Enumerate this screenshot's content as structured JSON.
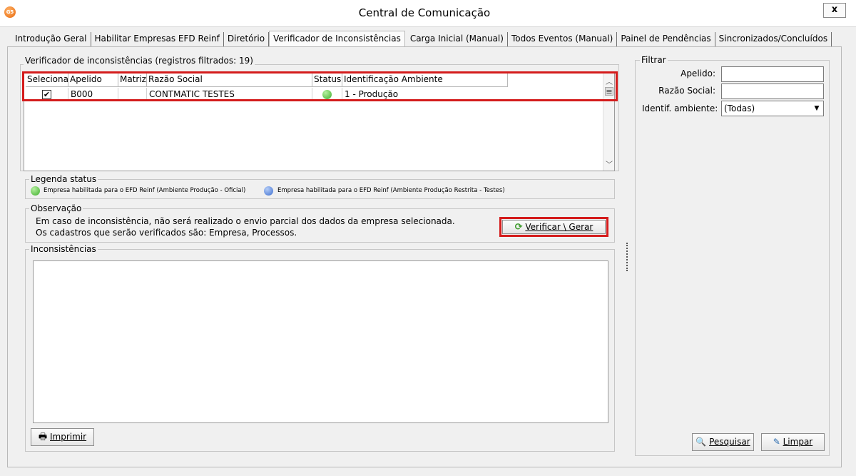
{
  "window": {
    "title": "Central de Comunicação",
    "close": "x",
    "app_icon": "G5"
  },
  "tabs": [
    {
      "label": "Introdução Geral",
      "active": false
    },
    {
      "label": "Habilitar Empresas EFD Reinf",
      "active": false
    },
    {
      "label": "Diretório",
      "active": false
    },
    {
      "label": "Verificador de Inconsistências",
      "active": true
    },
    {
      "label": "Carga Inicial (Manual)",
      "active": false
    },
    {
      "label": "Todos Eventos (Manual)",
      "active": false
    },
    {
      "label": "Painel de Pendências",
      "active": false
    },
    {
      "label": "Sincronizados/Concluídos",
      "active": false
    }
  ],
  "verifier": {
    "group_label": "Verificador de inconsistências (registros filtrados: 19)",
    "columns": [
      "Selecionar",
      "Apelido",
      "Matriz",
      "Razão Social",
      "Status",
      "Identificação Ambiente"
    ],
    "rows": [
      {
        "selected": true,
        "apelido": "B000",
        "matriz": "",
        "razao_social": "CONTMATIC  TESTES",
        "status_color": "#4cbb3a",
        "ambiente": "1 - Produção"
      }
    ]
  },
  "legend": {
    "group_label": "Legenda status",
    "items": [
      {
        "label": "Empresa habilitada para o EFD Reinf (Ambiente Produção - Oficial)",
        "color": "#4cbb3a"
      },
      {
        "label": "Empresa habilitada para o EFD Reinf (Ambiente Produção Restrita - Testes)",
        "color": "#3d6fd1"
      }
    ]
  },
  "observacao": {
    "group_label": "Observação",
    "line1": "Em caso de inconsistência, não será realizado o envio parcial dos dados da empresa selecionada.",
    "line2": "Os cadastros que serão verificados são: Empresa, Processos.",
    "verify_button": "Verificar \\ Gerar"
  },
  "inconsistencias": {
    "group_label": "Inconsistências",
    "text": "",
    "print_button": "Imprimir"
  },
  "filtrar": {
    "group_label": "Filtrar",
    "apelido_label": "Apelido:",
    "apelido_value": "",
    "razao_label": "Razão Social:",
    "razao_value": "",
    "ambiente_label": "Identif. ambiente:",
    "ambiente_value": "(Todas)",
    "search_button": "Pesquisar",
    "clear_button": "Limpar"
  },
  "colors": {
    "highlight": "#d41c1c",
    "ok_status": "#4cbb3a",
    "test_status": "#3d6fd1"
  }
}
